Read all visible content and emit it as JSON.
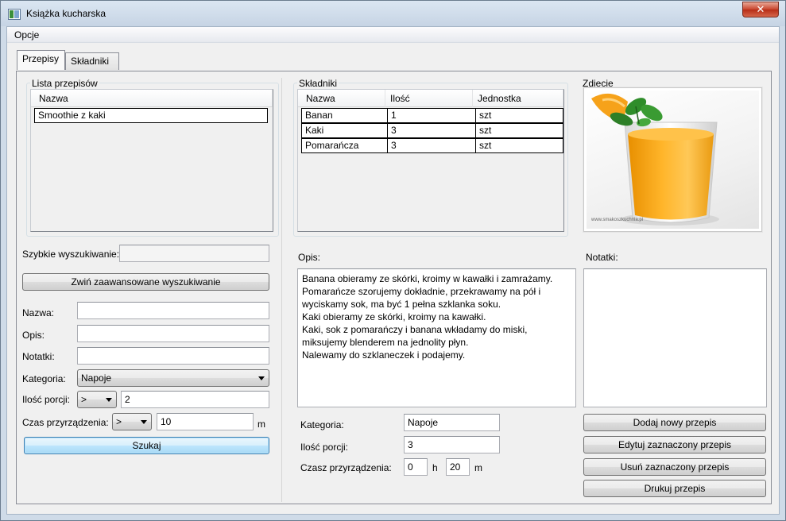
{
  "window": {
    "title": "Książka kucharska",
    "close_glyph": "✕"
  },
  "menu": {
    "options_label": "Opcje"
  },
  "tabs": [
    {
      "label": "Przepisy",
      "active": true
    },
    {
      "label": "Składniki",
      "active": false
    }
  ],
  "recipes": {
    "group_title": "Lista przepisów",
    "column_name": "Nazwa",
    "items": [
      "Smoothie z kaki"
    ]
  },
  "search": {
    "quick_label": "Szybkie wyszukiwanie:",
    "quick_value": "",
    "collapse_button": "Zwiń zaawansowane wyszukiwanie",
    "name_label": "Nazwa:",
    "name_value": "",
    "desc_label": "Opis:",
    "desc_value": "",
    "notes_label": "Notatki:",
    "notes_value": "",
    "category_label": "Kategoria:",
    "category_value": "Napoje",
    "portions_label": "Ilość porcji:",
    "portions_op": ">",
    "portions_value": "2",
    "time_label": "Czas przyrządzenia:",
    "time_op": ">",
    "time_value": "10",
    "time_unit": "m",
    "search_button": "Szukaj"
  },
  "ingredients": {
    "group_title": "Składniki",
    "columns": [
      "Nazwa",
      "Ilość",
      "Jednostka"
    ],
    "rows": [
      [
        "Banan",
        "1",
        "szt"
      ],
      [
        "Kaki",
        "3",
        "szt"
      ],
      [
        "Pomarańcza",
        "3",
        "szt"
      ]
    ]
  },
  "photo": {
    "group_title": "Zdjęcie",
    "watermark": "www.smakoszkuchnia.pl"
  },
  "details": {
    "desc_label": "Opis:",
    "description": "Banana obieramy ze skórki, kroimy w kawałki i zamrażamy.\nPomarańcze szorujemy dokładnie, przekrawamy na pół i wyciskamy sok, ma być 1 pełna szklanka soku.\nKaki obieramy ze skórki, kroimy na kawałki.\nKaki, sok z pomarańczy i banana wkładamy do miski, miksujemy blenderem na jednolity płyn.\nNalewamy do szklaneczek i podajemy.",
    "notes_label": "Notatki:",
    "notes": "",
    "category_label": "Kategoria:",
    "category": "Napoje",
    "portions_label": "Ilość porcji:",
    "portions": "3",
    "time_label": "Czasz przyrządzenia:",
    "hours": "0",
    "hours_unit": "h",
    "minutes": "20",
    "minutes_unit": "m"
  },
  "actions": {
    "add": "Dodaj nowy przepis",
    "edit": "Edytuj zaznaczony przepis",
    "delete": "Usuń zaznaczony przepis",
    "print": "Drukuj przepis"
  },
  "colors": {
    "accent": "#3c7fb1",
    "close": "#c8432b"
  }
}
